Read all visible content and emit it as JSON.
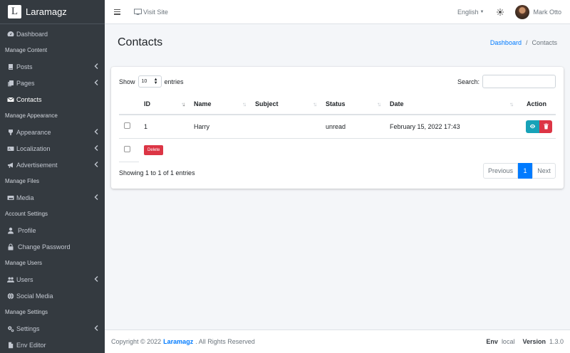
{
  "brand": {
    "logo_letter": "L",
    "name": "Laramagz"
  },
  "sidebar": {
    "items": [
      {
        "type": "item",
        "icon": "tachometer-icon",
        "label": "Dashboard"
      },
      {
        "type": "header",
        "label": "Manage Content"
      },
      {
        "type": "item",
        "icon": "book-icon",
        "label": "Posts",
        "chevron": true
      },
      {
        "type": "item",
        "icon": "copy-icon",
        "label": "Pages",
        "chevron": true
      },
      {
        "type": "item",
        "icon": "envelope-icon",
        "label": "Contacts",
        "active": true
      },
      {
        "type": "header",
        "label": "Manage Appearance"
      },
      {
        "type": "item",
        "icon": "brush-icon",
        "label": "Appearance",
        "chevron": true
      },
      {
        "type": "item",
        "icon": "language-icon",
        "label": "Localization",
        "chevron": true
      },
      {
        "type": "item",
        "icon": "bullhorn-icon",
        "label": "Advertisement",
        "chevron": true
      },
      {
        "type": "header",
        "label": "Manage Files"
      },
      {
        "type": "item",
        "icon": "photo-video-icon",
        "label": "Media",
        "chevron": true
      },
      {
        "type": "header",
        "label": "Account Settings"
      },
      {
        "type": "item",
        "icon": "user-icon",
        "label": "Profile",
        "indent": true
      },
      {
        "type": "item",
        "icon": "lock-icon",
        "label": "Change Password",
        "indent": true
      },
      {
        "type": "header",
        "label": "Manage Users"
      },
      {
        "type": "item",
        "icon": "users-icon",
        "label": "Users",
        "chevron": true
      },
      {
        "type": "item",
        "icon": "globe-icon",
        "label": "Social Media"
      },
      {
        "type": "header",
        "label": "Manage Settings"
      },
      {
        "type": "item",
        "icon": "cogs-icon",
        "label": "Settings",
        "chevron": true
      },
      {
        "type": "item",
        "icon": "file-icon",
        "label": "Env Editor"
      }
    ]
  },
  "topbar": {
    "visit_site": "Visit Site",
    "language": "English",
    "user_name": "Mark Otto"
  },
  "page": {
    "title": "Contacts",
    "breadcrumb": {
      "home": "Dashboard",
      "separator": "/",
      "current": "Contacts"
    }
  },
  "table": {
    "show_label": "Show",
    "page_size": "10",
    "entries_label": "entries",
    "search_label": "Search:",
    "search_value": "",
    "columns": {
      "id": "ID",
      "name": "Name",
      "subject": "Subject",
      "status": "Status",
      "date": "Date",
      "action": "Action"
    },
    "rows": [
      {
        "id": "1",
        "name": "Harry",
        "subject": "",
        "status": "unread",
        "date": "February 15, 2022 17:43"
      }
    ],
    "bulk_delete_label": "Delete",
    "info": "Showing 1 to 1 of 1 entries",
    "pagination": {
      "previous": "Previous",
      "current": "1",
      "next": "Next"
    }
  },
  "footer": {
    "copyright_prefix": "Copyright © 2022",
    "brand": "Laramagz",
    "rights": ". All Rights Reserved",
    "env_label": "Env",
    "env_value": "local",
    "version_label": "Version",
    "version_value": "1.3.0"
  },
  "colors": {
    "sidebar_bg": "#343a40",
    "primary": "#007bff",
    "danger": "#dc3545",
    "info": "#17a2b8"
  }
}
